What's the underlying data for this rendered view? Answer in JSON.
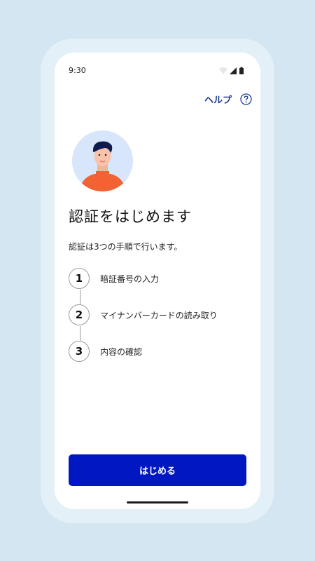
{
  "status_bar": {
    "time": "9:30",
    "icons": [
      "wifi-icon",
      "signal-icon",
      "battery-icon"
    ]
  },
  "header": {
    "help_label": "ヘルプ",
    "help_icon": "help-circle-icon"
  },
  "main": {
    "title": "認証をはじめます",
    "description": "認証は3つの手順で行います。",
    "steps": [
      {
        "number": "1",
        "label": "暗証番号の入力"
      },
      {
        "number": "2",
        "label": "マイナンバーカードの読み取り"
      },
      {
        "number": "3",
        "label": "内容の確認"
      }
    ]
  },
  "footer": {
    "start_button_label": "はじめる"
  },
  "colors": {
    "primary": "#0017c1",
    "help_link": "#1a3a8f",
    "avatar_bg": "#d7e6fb",
    "avatar_shirt": "#f26232",
    "background": "#d3e6f1"
  }
}
